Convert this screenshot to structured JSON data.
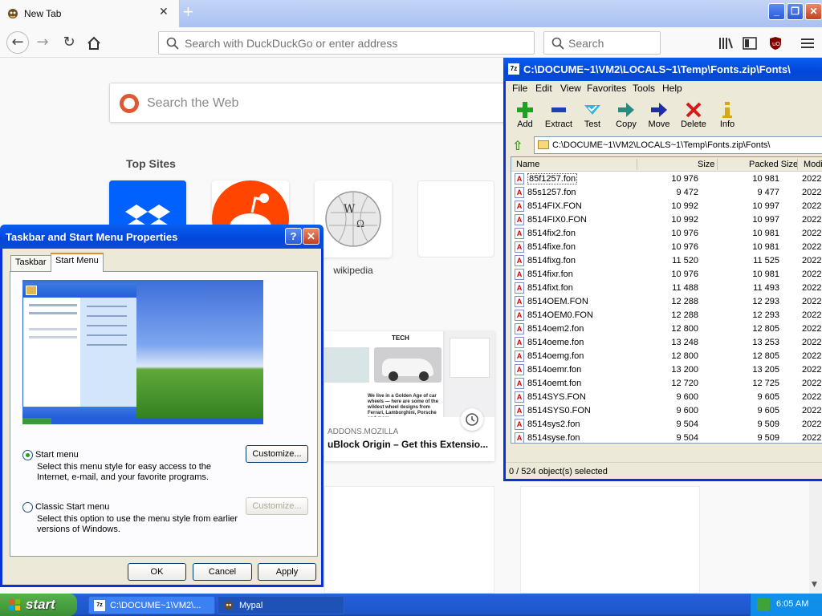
{
  "browser": {
    "tab_title": "New Tab",
    "url_placeholder": "Search with DuckDuckGo or enter address",
    "search_placeholder": "Search",
    "web_search_placeholder": "Search the Web",
    "top_sites_heading": "Top Sites",
    "top_sites": [
      {
        "label": "",
        "icon": "dropbox-icon"
      },
      {
        "label": "",
        "icon": "reddit-icon"
      },
      {
        "label": "wikipedia",
        "icon": "wikipedia-icon"
      },
      {
        "label": "",
        "icon": ""
      }
    ],
    "highlight": {
      "source": "ADDONS.MOZILLA",
      "title": "uBlock Origin – Get this Extensio...",
      "image_heading": "TECH",
      "image_caption": "We live in a Golden Age of car wheels — here are some of the wildest wheel designs from Ferrari, Lamborghini, Porsche and more"
    }
  },
  "sevenzip": {
    "title": "C:\\DOCUME~1\\VM2\\LOCALS~1\\Temp\\Fonts.zip\\Fonts\\",
    "menu": [
      "File",
      "Edit",
      "View",
      "Favorites",
      "Tools",
      "Help"
    ],
    "toolbar": [
      {
        "label": "Add",
        "icon": "add-icon",
        "color": "#21a121"
      },
      {
        "label": "Extract",
        "icon": "extract-icon",
        "color": "#1c3fb5"
      },
      {
        "label": "Test",
        "icon": "test-icon",
        "color": "#2bb7d8"
      },
      {
        "label": "Copy",
        "icon": "copy-icon",
        "color": "#2a8a80"
      },
      {
        "label": "Move",
        "icon": "move-icon",
        "color": "#1c2ea8"
      },
      {
        "label": "Delete",
        "icon": "delete-icon",
        "color": "#d61a1a"
      },
      {
        "label": "Info",
        "icon": "info-icon",
        "color": "#d6a51a"
      }
    ],
    "address": "C:\\DOCUME~1\\VM2\\LOCALS~1\\Temp\\Fonts.zip\\Fonts\\",
    "columns": [
      "Name",
      "Size",
      "Packed Size",
      "Modi"
    ],
    "rows": [
      {
        "name": "85f1257.fon",
        "size": "10 976",
        "packed": "10 981",
        "modified": "2022-"
      },
      {
        "name": "85s1257.fon",
        "size": "9 472",
        "packed": "9 477",
        "modified": "2022-"
      },
      {
        "name": "8514FIX.FON",
        "size": "10 992",
        "packed": "10 997",
        "modified": "2022-"
      },
      {
        "name": "8514FIX0.FON",
        "size": "10 992",
        "packed": "10 997",
        "modified": "2022-"
      },
      {
        "name": "8514fix2.fon",
        "size": "10 976",
        "packed": "10 981",
        "modified": "2022-"
      },
      {
        "name": "8514fixe.fon",
        "size": "10 976",
        "packed": "10 981",
        "modified": "2022-"
      },
      {
        "name": "8514fixg.fon",
        "size": "11 520",
        "packed": "11 525",
        "modified": "2022-"
      },
      {
        "name": "8514fixr.fon",
        "size": "10 976",
        "packed": "10 981",
        "modified": "2022-"
      },
      {
        "name": "8514fixt.fon",
        "size": "11 488",
        "packed": "11 493",
        "modified": "2022-"
      },
      {
        "name": "8514OEM.FON",
        "size": "12 288",
        "packed": "12 293",
        "modified": "2022-"
      },
      {
        "name": "8514OEM0.FON",
        "size": "12 288",
        "packed": "12 293",
        "modified": "2022-"
      },
      {
        "name": "8514oem2.fon",
        "size": "12 800",
        "packed": "12 805",
        "modified": "2022-"
      },
      {
        "name": "8514oeme.fon",
        "size": "13 248",
        "packed": "13 253",
        "modified": "2022-"
      },
      {
        "name": "8514oemg.fon",
        "size": "12 800",
        "packed": "12 805",
        "modified": "2022-"
      },
      {
        "name": "8514oemr.fon",
        "size": "13 200",
        "packed": "13 205",
        "modified": "2022-"
      },
      {
        "name": "8514oemt.fon",
        "size": "12 720",
        "packed": "12 725",
        "modified": "2022-"
      },
      {
        "name": "8514SYS.FON",
        "size": "9 600",
        "packed": "9 605",
        "modified": "2022-"
      },
      {
        "name": "8514SYS0.FON",
        "size": "9 600",
        "packed": "9 605",
        "modified": "2022-"
      },
      {
        "name": "8514sys2.fon",
        "size": "9 504",
        "packed": "9 509",
        "modified": "2022-"
      },
      {
        "name": "8514syse.fon",
        "size": "9 504",
        "packed": "9 509",
        "modified": "2022-"
      }
    ],
    "status": "0 / 524 object(s) selected"
  },
  "dialog": {
    "title": "Taskbar and Start Menu Properties",
    "tabs": [
      "Taskbar",
      "Start Menu"
    ],
    "option1": {
      "label": "Start menu",
      "desc": "Select this menu style for easy access to the Internet, e-mail, and your favorite programs.",
      "button": "Customize..."
    },
    "option2": {
      "label": "Classic Start menu",
      "desc": "Select this option to use the menu style from earlier versions of Windows.",
      "button": "Customize..."
    },
    "ok": "OK",
    "cancel": "Cancel",
    "apply": "Apply"
  },
  "taskbar": {
    "start": "start",
    "tasks": [
      {
        "label": "C:\\DOCUME~1\\VM2\\...",
        "icon": "7zip-icon"
      },
      {
        "label": "Mypal",
        "icon": "mypal-icon"
      }
    ],
    "clock": "6:05 AM"
  }
}
